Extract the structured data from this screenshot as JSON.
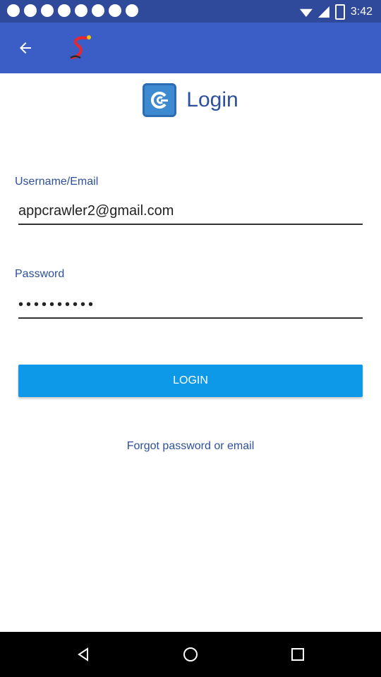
{
  "status_bar": {
    "time": "3:42"
  },
  "app_bar": {
    "back_icon": "arrow-left-icon",
    "logo_icon": "app-logo-icon"
  },
  "header": {
    "title": "Login",
    "logo_icon": "app-logo-icon"
  },
  "form": {
    "username_label": "Username/Email",
    "username_value": "appcrawler2@gmail.com",
    "password_label": "Password",
    "password_value": "••••••••••",
    "login_label": "LOGIN",
    "forgot_label": "Forgot password or email"
  },
  "colors": {
    "status_bar": "#2f4a9a",
    "app_bar": "#3b5ec6",
    "accent": "#0e98e8",
    "text_primary": "#2e4f9b"
  },
  "nav_bar": {
    "back_icon": "triangle-back-icon",
    "home_icon": "circle-home-icon",
    "recents_icon": "square-recents-icon"
  }
}
